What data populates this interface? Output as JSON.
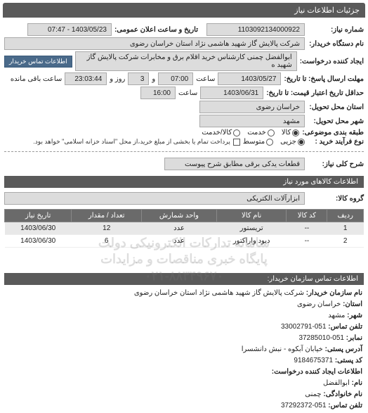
{
  "header": {
    "title": "جزئیات اطلاعات نیاز"
  },
  "fields": {
    "need_no_label": "شماره نیاز:",
    "need_no": "1103092134000922",
    "announce_label": "تاریخ و ساعت اعلان عمومی:",
    "announce_value": "1403/05/23 - 07:47",
    "buyer_org_label": "نام دستگاه خریدار:",
    "buyer_org": "شرکت پالایش گاز شهید هاشمی نژاد   استان خراسان رضوی",
    "requester_label": "ایجاد کننده درخواست:",
    "requester": "ابوالفضل چمنی کارشناس خرید اقلام برق و مخابرات شرکت پالایش گاز شهید ه",
    "contact_btn": "اطلاعات تماس خریدار",
    "deadline_label": "مهلت ارسال پاسخ: تا تاریخ:",
    "deadline_date": "1403/05/27",
    "deadline_time_label": "ساعت",
    "deadline_time": "07:00",
    "deadline_days_label": "و",
    "deadline_days": "3",
    "deadline_remain_label": "روز و",
    "deadline_remain": "23:03:44",
    "deadline_remain_suffix": "ساعت باقی مانده",
    "validity_label": "حداقل تاریخ اعتبار قیمت: تا تاریخ:",
    "validity_date": "1403/06/31",
    "validity_time_label": "ساعت",
    "validity_time": "16:00",
    "province_label": "استان محل تحویل:",
    "province": "خراسان رضوی",
    "city_label": "شهر محل تحویل:",
    "city": "مشهد",
    "category_label": "طبقه بندی موضوعی:",
    "cat_goods": "کالا",
    "cat_service": "خدمت",
    "cat_both": "کالا/خدمت",
    "buy_type_label": "نوع فرآیند خرید :",
    "buy_low": "جزیی",
    "buy_mid": "متوسط",
    "buy_note": "پرداخت تمام یا بخشی از مبلغ خرید،از محل \"اسناد خزانه اسلامی\" خواهد بود.",
    "desc_label": "شرح کلی نیاز:",
    "desc": "قطعات یدکی برقی مطابق شرح پیوست"
  },
  "items_header": "اطلاعات کالاهای مورد نیاز",
  "group_label": "گروه کالا:",
  "group_value": "ابزارآلات الکتریکی",
  "table": {
    "cols": [
      "ردیف",
      "کد کالا",
      "نام کالا",
      "واحد شمارش",
      "تعداد / مقدار",
      "تاریخ نیاز"
    ],
    "rows": [
      {
        "n": "1",
        "code": "--",
        "name": "تریستور",
        "unit": "عدد",
        "qty": "12",
        "date": "1403/06/30"
      },
      {
        "n": "2",
        "code": "--",
        "name": "دیود واراکتور",
        "unit": "عدد",
        "qty": "6",
        "date": "1403/06/30"
      }
    ]
  },
  "watermark": {
    "line1": "سامانه تدارکات الکترونیکی دولت",
    "line2": "پایگاه خبری مناقصات و مزایدات",
    "line3": "۰۲۱-۸۸۳۴۹۶۷۰"
  },
  "contact": {
    "header": "اطلاعات تماس سازمان خریدار:",
    "org_label": "نام سازمان خریدار:",
    "org": "شرکت پالایش گاز شهید هاشمی نژاد استان خراسان رضوی",
    "province_label": "استان:",
    "province": "خراسان رضوی",
    "city_label": "شهر:",
    "city": "مشهد",
    "phone_label": "تلفن تماس:",
    "phone": "051-33002791",
    "fax_label": "نمابر:",
    "fax": "051-37285010",
    "addr_label": "آدرس پستی:",
    "addr": "خیابان آبکوه - نبش دانشسرا",
    "postal_label": "کد پستی:",
    "postal": "9184675371",
    "req_contact_header": "اطلاعات ایجاد کننده درخواست:",
    "name_label": "نام:",
    "name": "ابوالفضل",
    "lname_label": "نام خانوادگی:",
    "lname": "چمنی",
    "rphone_label": "تلفن تماس:",
    "rphone": "051-37292372"
  }
}
